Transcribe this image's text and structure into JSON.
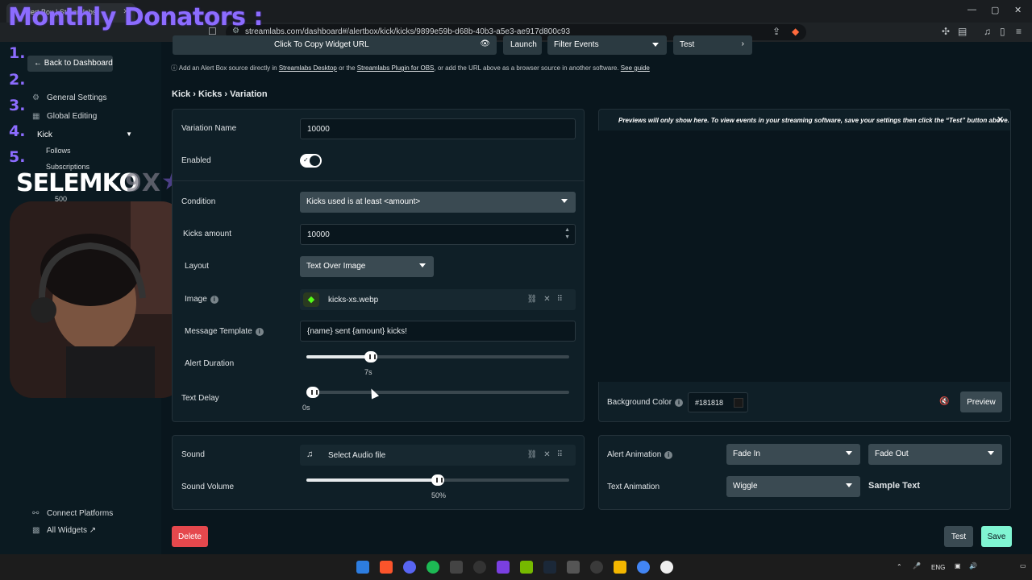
{
  "browser": {
    "tab_title": "Alert Box | Streamlabs",
    "url": "streamlabs.com/dashboard#/alertbox/kick/kicks/9899e59b-d68b-40b3-a5e3-ae917d800c93",
    "window_controls": [
      "—",
      "▢",
      "✕"
    ]
  },
  "overlay": {
    "donators_title": "Monthly Donators :",
    "donor_numbers": [
      "1.",
      "2.",
      "3.",
      "4.",
      "5."
    ],
    "streamer_name": "SELEMKO",
    "streamer_badge": "9X",
    "kicks_count": "500"
  },
  "sidebar": {
    "back_label": "Back to Dashboard",
    "items": [
      {
        "label": "General Settings",
        "icon": "gear-icon"
      },
      {
        "label": "Global Editing",
        "icon": "grid-icon"
      },
      {
        "label": "Kick",
        "icon": "chevron-down-icon"
      },
      {
        "label": "Follows",
        "icon": ""
      },
      {
        "label": "Subscriptions",
        "icon": ""
      }
    ],
    "bottom": [
      {
        "label": "Connect Platforms",
        "icon": "link-icon"
      },
      {
        "label": "All Widgets",
        "icon": "apps-icon"
      }
    ]
  },
  "topbar": {
    "copy_url_label": "Click To Copy Widget URL",
    "launch_label": "Launch",
    "filter_label": "Filter Events",
    "test_label": "Test"
  },
  "source_note": {
    "prefix": "Add an Alert Box source directly in ",
    "link1": "Streamlabs Desktop",
    "mid": " or the ",
    "link2": "Streamlabs Plugin for OBS",
    "suffix": ", or add the URL above as a browser source in another software. ",
    "link3": "See guide"
  },
  "breadcrumb": "Kick › Kicks › Variation",
  "form": {
    "variation_name_label": "Variation Name",
    "variation_name_value": "10000",
    "enabled_label": "Enabled",
    "enabled": true,
    "condition_label": "Condition",
    "condition_value": "Kicks used is at least <amount>",
    "kicks_amount_label": "Kicks amount",
    "kicks_amount_value": "10000",
    "layout_label": "Layout",
    "layout_value": "Text Over Image",
    "image_label": "Image",
    "image_file": "kicks-xs.webp",
    "message_template_label": "Message Template",
    "message_template_value": "{name} sent {amount} kicks!",
    "alert_duration_label": "Alert Duration",
    "alert_duration_value": "7s",
    "alert_duration_fraction": 0.245,
    "text_delay_label": "Text Delay",
    "text_delay_value": "0s",
    "text_delay_fraction": 0.0
  },
  "sound": {
    "sound_label": "Sound",
    "sound_file": "Select Audio file",
    "volume_label": "Sound Volume",
    "volume_value": "50%",
    "volume_fraction": 0.5
  },
  "preview": {
    "note": "Previews will only show here. To view events in your streaming software, save your settings then click the “Test” button above.",
    "bg_color_label": "Background Color",
    "bg_color_value": "#181818",
    "preview_label": "Preview"
  },
  "animation": {
    "alert_animation_label": "Alert Animation",
    "in_value": "Fade In",
    "out_value": "Fade Out",
    "text_animation_label": "Text Animation",
    "text_value": "Wiggle",
    "sample_text": "Sample Text"
  },
  "actions": {
    "delete_label": "Delete",
    "test_label": "Test",
    "save_label": "Save"
  },
  "taskbar": {
    "lang": "ENG"
  },
  "colors": {
    "accent": "#80f5d2",
    "danger": "#e5484d",
    "overlay_purple": "#8c6cff"
  }
}
